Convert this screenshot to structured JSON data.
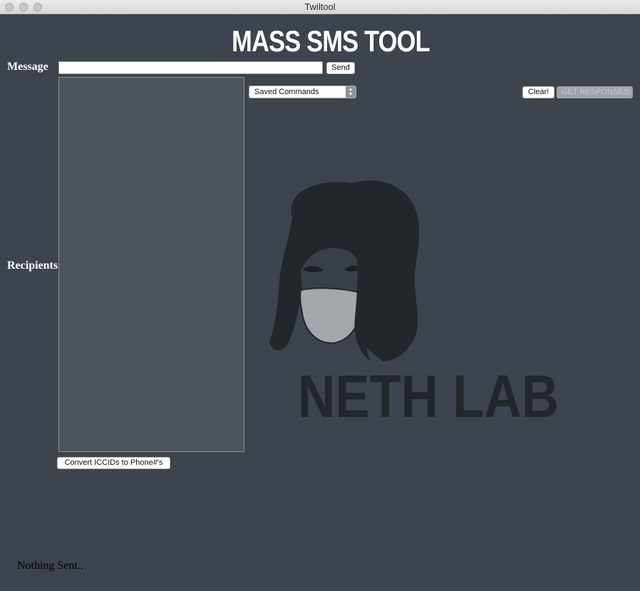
{
  "window": {
    "title": "Twiltool"
  },
  "header": {
    "title": "MASS SMS TOOL"
  },
  "message": {
    "label": "Message",
    "value": "",
    "send_label": "Send"
  },
  "recipients": {
    "label": "Recipients",
    "value": ""
  },
  "saved_commands": {
    "selected": "Saved Commands"
  },
  "actions": {
    "clear_label": "Clear!",
    "get_responses_label": "GET RESPONSES!"
  },
  "convert": {
    "label": "Convert ICCIDs to Phone#'s"
  },
  "logo": {
    "text": "NETH LAB"
  },
  "status": {
    "text": "Nothing Sent.."
  },
  "colors": {
    "background": "#3d444d",
    "recipients_bg": "#4d545c",
    "logo_dark": "#22272c"
  }
}
